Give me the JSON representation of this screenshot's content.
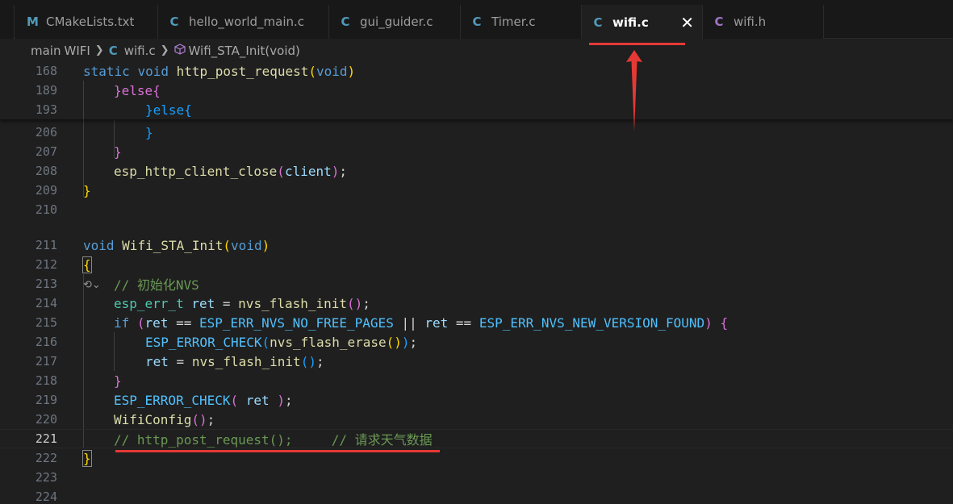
{
  "tabs": [
    {
      "icon": "M",
      "label": "CMakeLists.txt"
    },
    {
      "icon": "C",
      "label": "hello_world_main.c"
    },
    {
      "icon": "C",
      "label": "gui_guider.c"
    },
    {
      "icon": "C",
      "label": "Timer.c"
    },
    {
      "icon": "C",
      "label": "wifi.c",
      "close": "✕"
    },
    {
      "icon": "C",
      "label": "wifi.h"
    }
  ],
  "breadcrumb": {
    "folder1": "main",
    "folder2": "WIFI",
    "file_icon": "C",
    "file": "wifi.c",
    "symbol": "Wifi_STA_Init(void)"
  },
  "sticky": {
    "lines": [
      {
        "num": "168",
        "text": "static void http_post_request(void)"
      },
      {
        "num": "189",
        "text": "}else{"
      },
      {
        "num": "193",
        "text": "}else{"
      }
    ]
  },
  "code": {
    "lines": [
      {
        "num": "206",
        "text": "}"
      },
      {
        "num": "207",
        "text": "}"
      },
      {
        "num": "208",
        "text": "esp_http_client_close(client);"
      },
      {
        "num": "209",
        "text": "}"
      },
      {
        "num": "210",
        "text": ""
      },
      {
        "num": "211",
        "text": "void Wifi_STA_Init(void)"
      },
      {
        "num": "212",
        "text": "{"
      },
      {
        "num": "213",
        "text": "// 初始化NVS"
      },
      {
        "num": "214",
        "text": "esp_err_t ret = nvs_flash_init();"
      },
      {
        "num": "215",
        "text": "if (ret == ESP_ERR_NVS_NO_FREE_PAGES || ret == ESP_ERR_NVS_NEW_VERSION_FOUND) {"
      },
      {
        "num": "216",
        "text": "ESP_ERROR_CHECK(nvs_flash_erase());"
      },
      {
        "num": "217",
        "text": "ret = nvs_flash_init();"
      },
      {
        "num": "218",
        "text": "}"
      },
      {
        "num": "219",
        "text": "ESP_ERROR_CHECK( ret );"
      },
      {
        "num": "220",
        "text": "WifiConfig();"
      },
      {
        "num": "221",
        "text": "// http_post_request();     // 请求天气数据"
      },
      {
        "num": "222",
        "text": "}"
      },
      {
        "num": "223",
        "text": ""
      },
      {
        "num": "224",
        "text": ""
      }
    ],
    "codelens_glyph": "⟲⌄",
    "current_line": "221"
  },
  "colors": {
    "annotation_red": "#e53935",
    "editor_bg": "#1f1f1f",
    "keyword": "#569cd6",
    "function": "#dcdcaa",
    "comment": "#6a9955"
  }
}
